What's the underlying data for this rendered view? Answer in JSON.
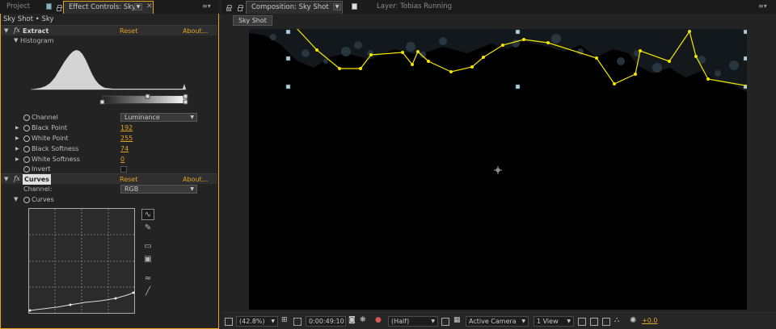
{
  "left_panel": {
    "tabs": [
      {
        "label": "Project"
      },
      {
        "label": "Effect Controls: Sky"
      }
    ],
    "breadcrumb": "Sky Shot • Sky",
    "effects": [
      {
        "name": "Extract",
        "reset": "Reset",
        "about": "About..."
      },
      {
        "name": "Curves",
        "reset": "Reset",
        "about": "About..."
      }
    ],
    "extract": {
      "histogram_label": "Histogram",
      "channel_label": "Channel",
      "channel_value": "Luminance",
      "params": [
        {
          "label": "Black Point",
          "value": "192"
        },
        {
          "label": "White Point",
          "value": "255"
        },
        {
          "label": "Black Softness",
          "value": "74"
        },
        {
          "label": "White Softness",
          "value": "0"
        }
      ],
      "invert_label": "Invert"
    },
    "curves": {
      "channel_label": "Channel:",
      "channel_value": "RGB",
      "curves_label": "Curves"
    },
    "icons": [
      "stopwatch-icon",
      "curve-tool-icon",
      "pencil-tool-icon",
      "open-folder-icon",
      "save-icon",
      "smooth-icon",
      "reset-line-icon"
    ]
  },
  "comp_panel": {
    "tabs": [
      {
        "label": "Composition: Sky Shot"
      },
      {
        "label": "Layer: Tobias Running"
      }
    ],
    "subtab": "Sky Shot",
    "bottom_bar": {
      "zoom": "(42.8%)",
      "timecode": "0:00:49:10",
      "resolution": "(Half)",
      "camera": "Active Camera",
      "view": "1 View",
      "exposure": "+0.0"
    }
  },
  "colors": {
    "accent": "#e5a322",
    "track_line": "#f2e600",
    "handle": "#a9d6de",
    "tab_square": "#8fb3c4"
  }
}
